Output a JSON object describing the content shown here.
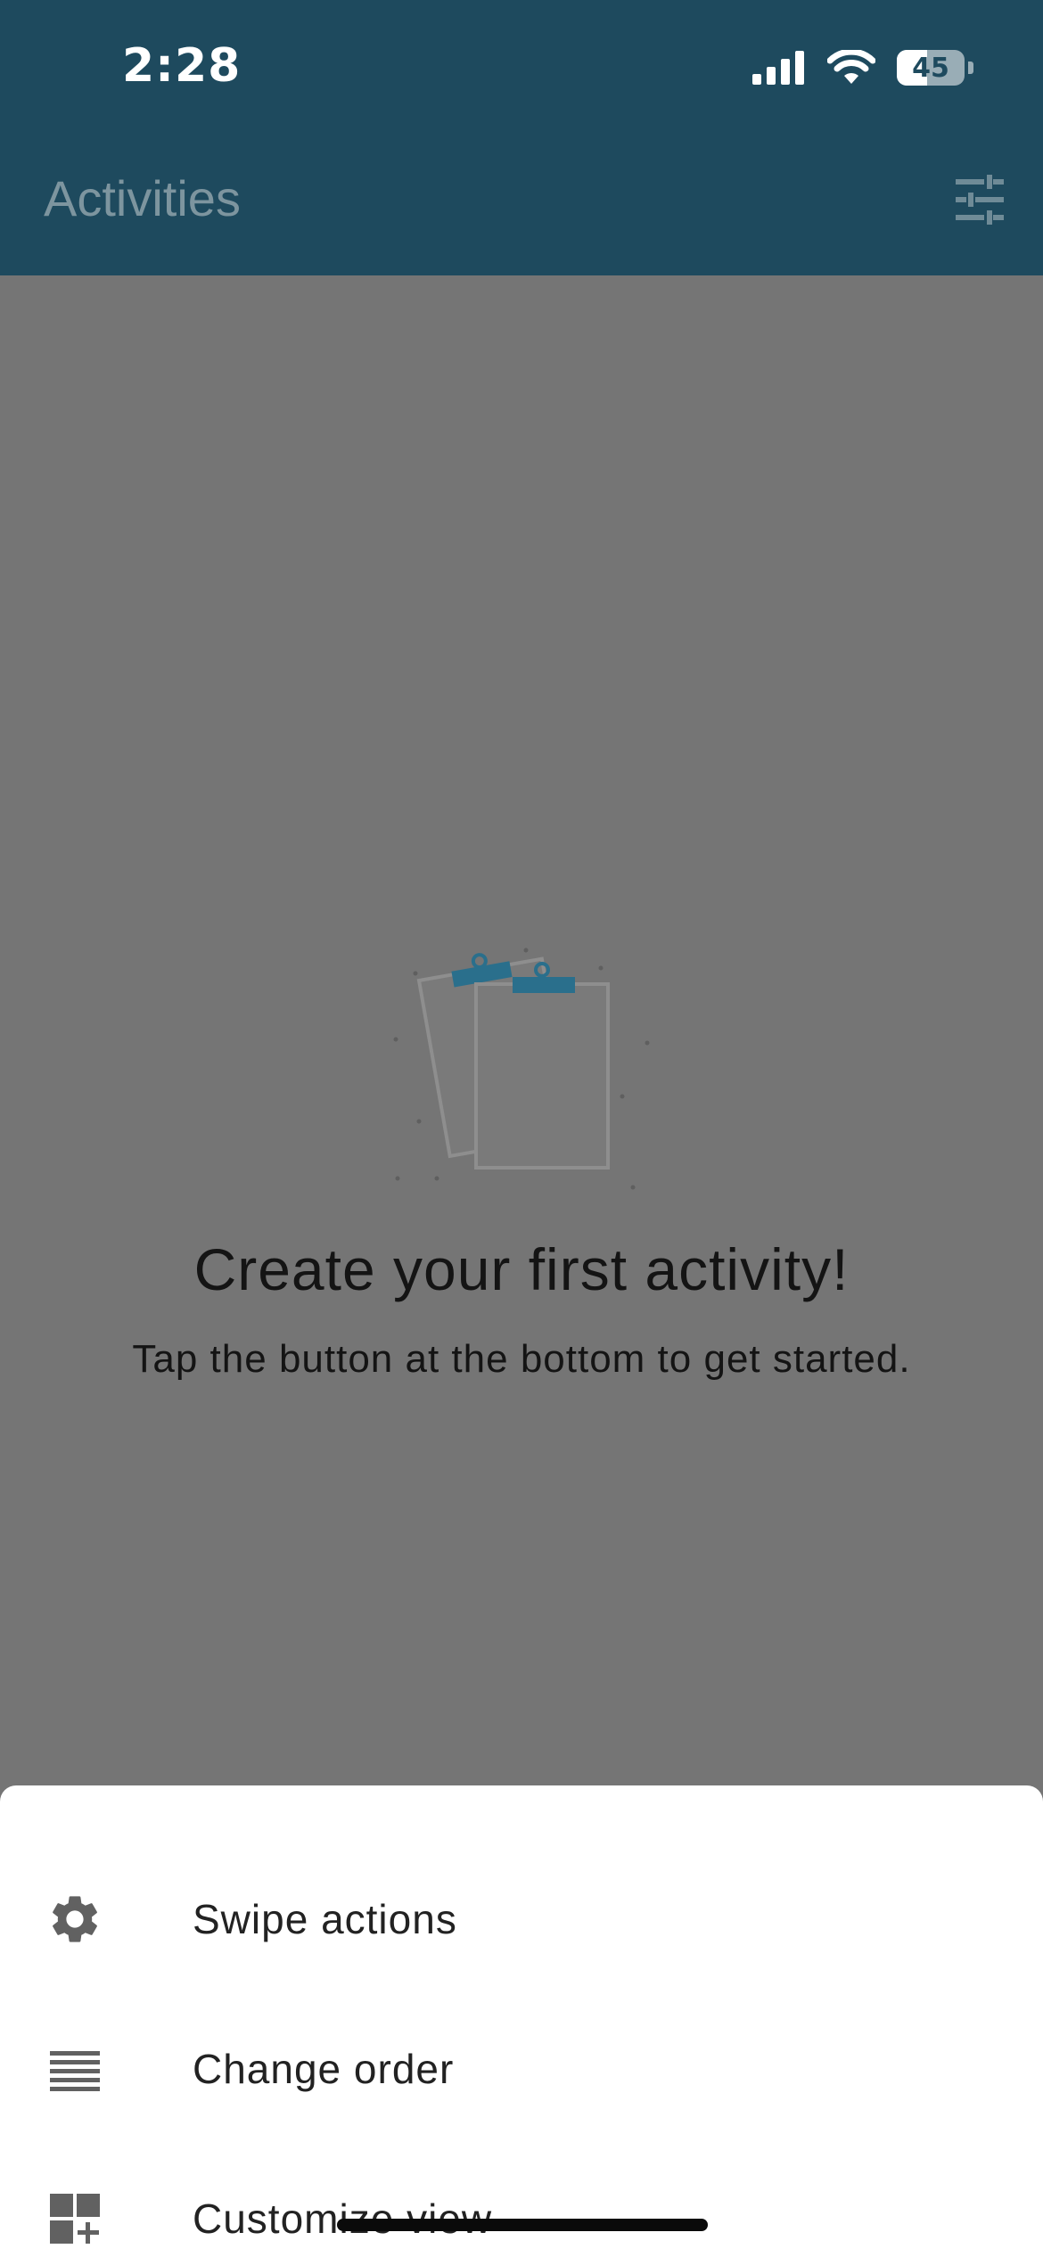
{
  "status_bar": {
    "time": "2:28",
    "battery": "45",
    "battery_level": 0.45,
    "icons": [
      "cellular-signal-icon",
      "wifi-icon",
      "battery-icon"
    ]
  },
  "header": {
    "title": "Activities",
    "filter_icon": "tune-sliders-icon"
  },
  "empty_state": {
    "illustration": "clipboards-icon",
    "title": "Create your first activity!",
    "subtitle": "Tap the button at the bottom to get started."
  },
  "bottom_sheet": {
    "items": [
      {
        "label": "Swipe actions",
        "icon": "gear-icon"
      },
      {
        "label": "Change order",
        "icon": "reorder-lines-icon"
      },
      {
        "label": "Customize view",
        "icon": "dashboard-add-icon"
      }
    ]
  },
  "colors": {
    "header_bg": "#1e4a5e",
    "overlay_bg": "#757575",
    "accent": "#2a6f8c",
    "sheet_bg": "#ffffff",
    "icon_gray": "#616161"
  }
}
